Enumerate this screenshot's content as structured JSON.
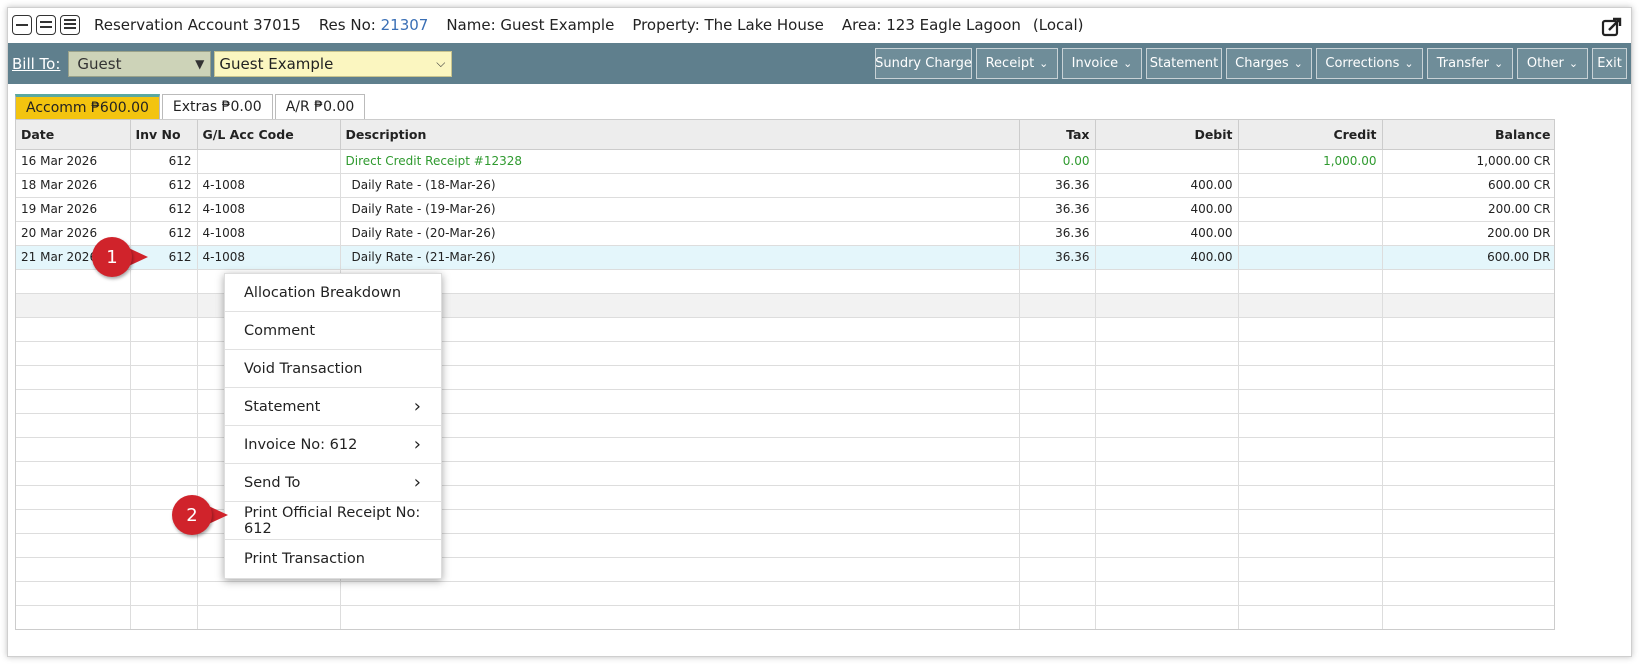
{
  "header": {
    "account": "Reservation Account 37015",
    "res_label": "Res No:",
    "res_no": "21307",
    "name": "Name: Guest Example",
    "property": "Property: The Lake House",
    "area": "Area: 123 Eagle Lagoon",
    "local": "(Local)"
  },
  "toolbar": {
    "bill_to": "Bill To:",
    "bill_type": "Guest",
    "guest_name": "Guest Example",
    "buttons": {
      "sundry": "Sundry Charge",
      "receipt": "Receipt",
      "invoice": "Invoice",
      "statement": "Statement",
      "charges": "Charges",
      "corrections": "Corrections",
      "transfer": "Transfer",
      "other": "Other",
      "exit": "Exit"
    }
  },
  "tabs": {
    "accomm": "Accomm ₱600.00",
    "extras": "Extras ₱0.00",
    "ar": "A/R ₱0.00"
  },
  "table": {
    "headers": {
      "date": "Date",
      "inv": "Inv No",
      "gl": "G/L Acc Code",
      "desc": "Description",
      "tax": "Tax",
      "debit": "Debit",
      "credit": "Credit",
      "balance": "Balance"
    },
    "rows": [
      {
        "date": "16 Mar 2026",
        "inv": "612",
        "gl": "",
        "desc": "Direct Credit Receipt #12328",
        "tax": "0.00",
        "debit": "",
        "credit": "1,000.00",
        "balance": "1,000.00 CR"
      },
      {
        "date": "18 Mar 2026",
        "inv": "612",
        "gl": "4-1008",
        "desc": "Daily Rate  - (18-Mar-26)",
        "tax": "36.36",
        "debit": "400.00",
        "credit": "",
        "balance": "600.00 CR"
      },
      {
        "date": "19 Mar 2026",
        "inv": "612",
        "gl": "4-1008",
        "desc": "Daily Rate  - (19-Mar-26)",
        "tax": "36.36",
        "debit": "400.00",
        "credit": "",
        "balance": "200.00 CR"
      },
      {
        "date": "20 Mar 2026",
        "inv": "612",
        "gl": "4-1008",
        "desc": "Daily Rate  - (20-Mar-26)",
        "tax": "36.36",
        "debit": "400.00",
        "credit": "",
        "balance": "200.00 DR"
      },
      {
        "date": "21 Mar 2026",
        "inv": "612",
        "gl": "4-1008",
        "desc": "Daily Rate  - (21-Mar-26)",
        "tax": "36.36",
        "debit": "400.00",
        "credit": "",
        "balance": "600.00 DR"
      }
    ]
  },
  "menu": {
    "allocation": "Allocation Breakdown",
    "comment": "Comment",
    "void": "Void Transaction",
    "statement": "Statement",
    "invoice": "Invoice No: 612",
    "send": "Send To",
    "print_receipt": "Print Official Receipt No: 612",
    "print_tx": "Print Transaction"
  },
  "callouts": {
    "one": "1",
    "two": "2"
  },
  "colors": {
    "toolbar": "#5f7f8d",
    "active_tab": "#f3c40f",
    "callout": "#d0232b",
    "link": "#3a6fb5",
    "green_text": "#2f9a2f"
  }
}
